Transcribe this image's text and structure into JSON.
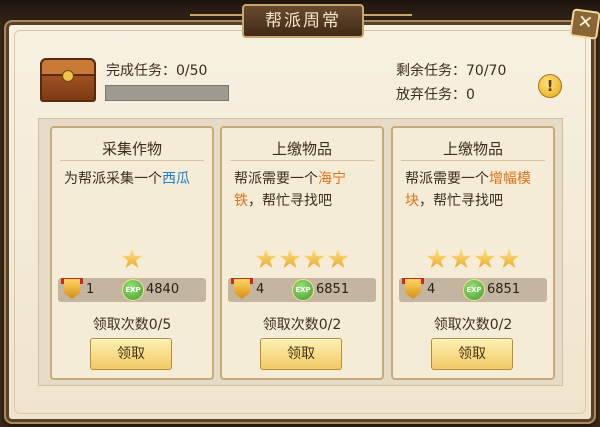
{
  "window": {
    "title": "帮派周常",
    "close_symbol": "✕"
  },
  "summary": {
    "completed_label": "完成任务：",
    "completed_value": "0/50",
    "progress_fraction": 0,
    "remaining_label": "剩余任务：",
    "remaining_value": "70/70",
    "abandoned_label": "放弃任务：",
    "abandoned_value": "0",
    "info_symbol": "!"
  },
  "exp_coin_text": "EXP",
  "tasks": [
    {
      "title": "采集作物",
      "desc_prefix": "为帮派采集一个",
      "desc_item": "西瓜",
      "desc_suffix": "",
      "item_color": "blue",
      "stars": 1,
      "medal_reward": "1",
      "exp_reward": "4840",
      "count_text": "领取次数0/5",
      "claim_label": "领取"
    },
    {
      "title": "上缴物品",
      "desc_prefix": "帮派需要一个",
      "desc_item": "海宁铁",
      "desc_suffix": "，帮忙寻找吧",
      "item_color": "orange",
      "stars": 4,
      "medal_reward": "4",
      "exp_reward": "6851",
      "count_text": "领取次数0/2",
      "claim_label": "领取"
    },
    {
      "title": "上缴物品",
      "desc_prefix": "帮派需要一个",
      "desc_item": "增幅模块",
      "desc_suffix": "，帮忙寻找吧",
      "item_color": "orange",
      "stars": 4,
      "medal_reward": "4",
      "exp_reward": "6851",
      "count_text": "领取次数0/2",
      "claim_label": "领取"
    }
  ]
}
